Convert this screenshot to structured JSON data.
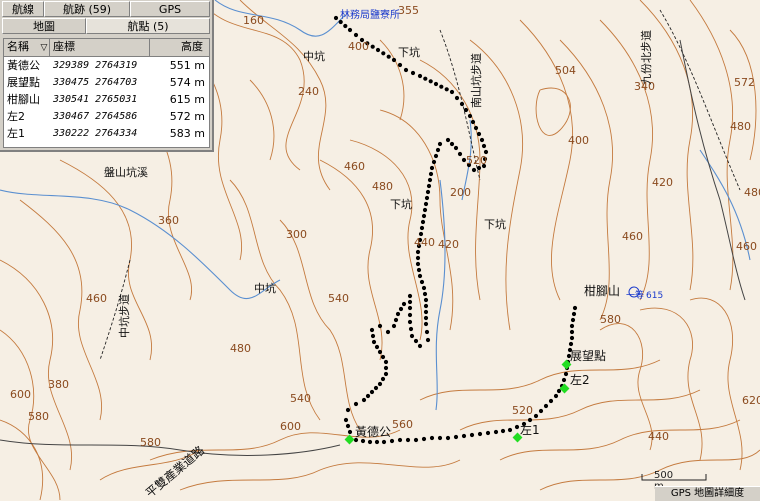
{
  "panel": {
    "tabs_top": [
      "航線",
      "航跡 (59)",
      "GPS"
    ],
    "tabs_bottom": [
      "地圖",
      "航點 (5)"
    ],
    "columns": [
      "名稱",
      "座標",
      "高度"
    ],
    "waypoints": [
      {
        "name": "黃德公",
        "coord": "329389 2764319",
        "alt": "551 m"
      },
      {
        "name": "展望點",
        "coord": "330475 2764703",
        "alt": "574 m"
      },
      {
        "name": "柑腳山",
        "coord": "330541 2765031",
        "alt": "615 m"
      },
      {
        "name": "左2",
        "coord": "330467 2764586",
        "alt": "572 m"
      },
      {
        "name": "左1",
        "coord": "330222 2764334",
        "alt": "583 m"
      }
    ]
  },
  "map": {
    "labels": {
      "station": "林務局鹽寮所",
      "xiakeng1": "下坑",
      "xiakeng2": "下坑",
      "xiakeng3": "下坑",
      "zhongkeng1": "中坑",
      "zhongkeng2": "中坑",
      "panshan": "盤山坑溪",
      "trail1": "中坑步道",
      "trail2": "南山坑步道",
      "trail3": "九份北步道",
      "road": "平雙產業道路",
      "peak": "柑腳山",
      "peak_tri": "一等",
      "peak_alt": "615",
      "wp1": "黃德公",
      "wp2": "展望點",
      "wp3": "左2",
      "wp4": "左1"
    },
    "contours": [
      "160",
      "355",
      "400",
      "240",
      "504",
      "572",
      "340",
      "400",
      "480",
      "460",
      "480",
      "360",
      "300",
      "200",
      "440",
      "420",
      "520",
      "540",
      "460",
      "380",
      "480",
      "460",
      "540",
      "560",
      "520",
      "580",
      "580",
      "440",
      "600",
      "580",
      "600",
      "620",
      "420",
      "480",
      "460"
    ]
  },
  "scale_label": "500 m",
  "status_label": "GPS 地圖詳細度",
  "colors": {
    "contour": "#c47a3e",
    "water": "#5a8fd0",
    "track": "#000000",
    "waypoint": "#22dd22",
    "panel": "#d4d0c8"
  }
}
